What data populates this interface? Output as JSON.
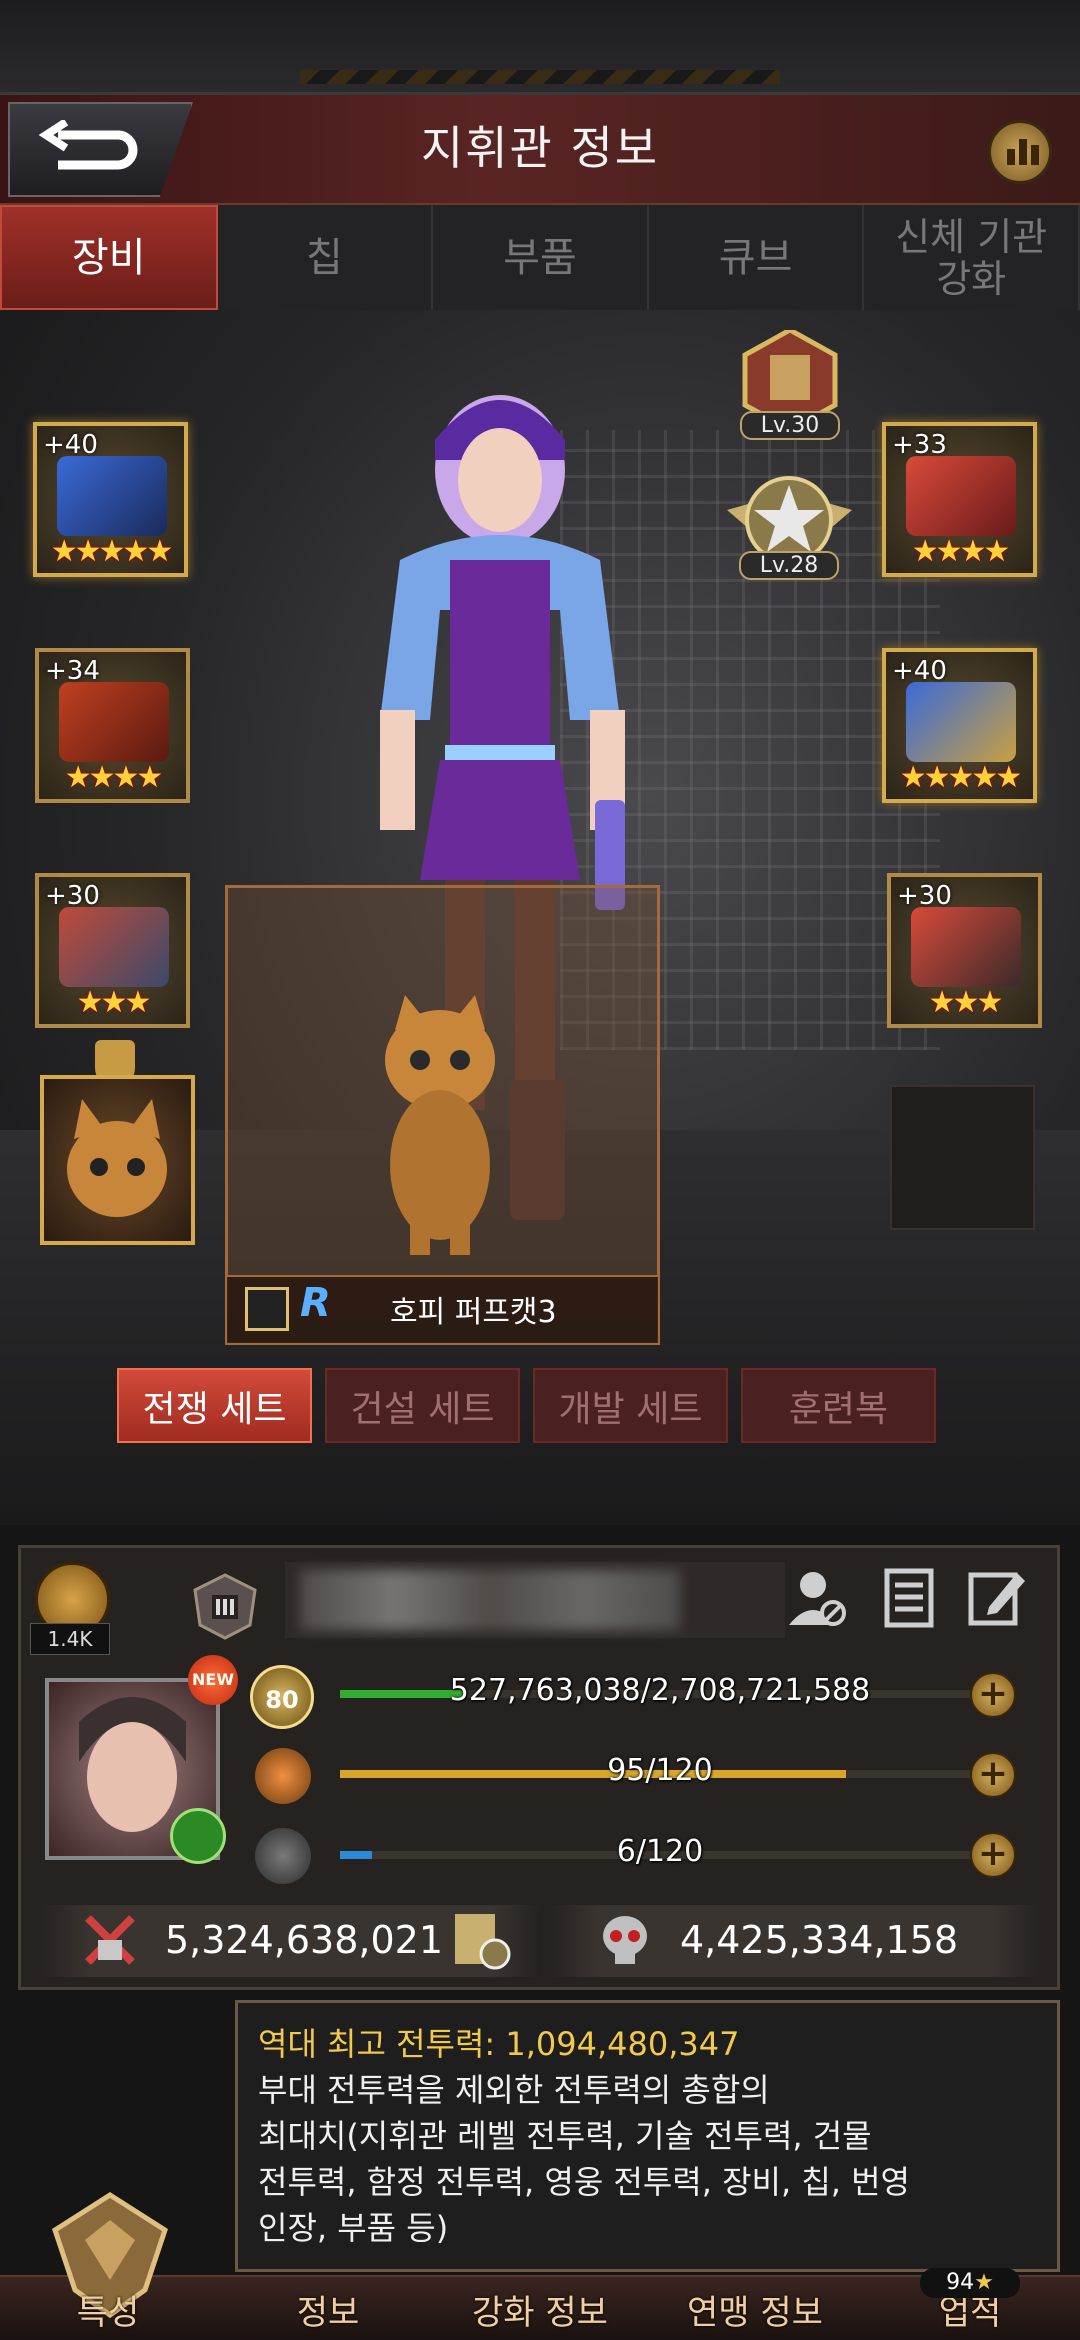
{
  "header": {
    "title": "지휘관 정보"
  },
  "tabs": [
    {
      "label": "장비",
      "active": true
    },
    {
      "label": "칩",
      "active": false
    },
    {
      "label": "부품",
      "active": false
    },
    {
      "label": "큐브",
      "active": false
    },
    {
      "label": "신체 기관\n강화",
      "active": false
    }
  ],
  "equipment": {
    "left": [
      {
        "plus": "+40",
        "stars": "★★★★★"
      },
      {
        "plus": "+34",
        "stars": "★★★★"
      },
      {
        "plus": "+30",
        "stars": "★★★"
      }
    ],
    "right": [
      {
        "plus": "+33",
        "stars": "★★★★"
      },
      {
        "plus": "+40",
        "stars": "★★★★★"
      },
      {
        "plus": "+30",
        "stars": "★★★"
      }
    ],
    "badges": [
      {
        "lv": "Lv.30"
      },
      {
        "lv": "Lv.28"
      }
    ]
  },
  "pet": {
    "rarity": "R",
    "name": "호피 퍼프캣3"
  },
  "sets": [
    {
      "label": "전쟁 세트",
      "active": true
    },
    {
      "label": "건설 세트",
      "active": false
    },
    {
      "label": "개발 세트",
      "active": false
    },
    {
      "label": "훈련복",
      "active": false
    }
  ],
  "profile": {
    "likes": "1.4K",
    "level": "80",
    "new_badge": "NEW",
    "exp": {
      "text": "527,763,038/2,708,721,588",
      "fraction": 0.195
    },
    "stamina": {
      "text": "95/120",
      "fraction": 0.79
    },
    "energy": {
      "text": "6/120",
      "fraction": 0.05
    },
    "power": "5,324,638,021",
    "kills": "4,425,334,158"
  },
  "tooltip": {
    "heading": "역대 최고 전투력: 1,094,480,347",
    "lines": [
      "부대 전투력을 제외한 전투력의 총합의",
      "최대치(지휘관 레벨 전투력, 기술 전투력, 건물",
      "전투력, 함정 전투력, 영웅 전투력, 장비, 칩, 번영",
      "인장, 부품 등)"
    ]
  },
  "bottom_nav": [
    {
      "label": "특성"
    },
    {
      "label": "정보"
    },
    {
      "label": "강화 정보"
    },
    {
      "label": "연맹 정보"
    },
    {
      "label": "업적"
    }
  ],
  "achievement_count": "94",
  "colors": {
    "accent": "#c24a3a",
    "gold": "#d5aa4c",
    "exp_bar": "#2fae2f",
    "stamina_bar": "#d8a62a",
    "energy_bar": "#2a8ad8"
  }
}
